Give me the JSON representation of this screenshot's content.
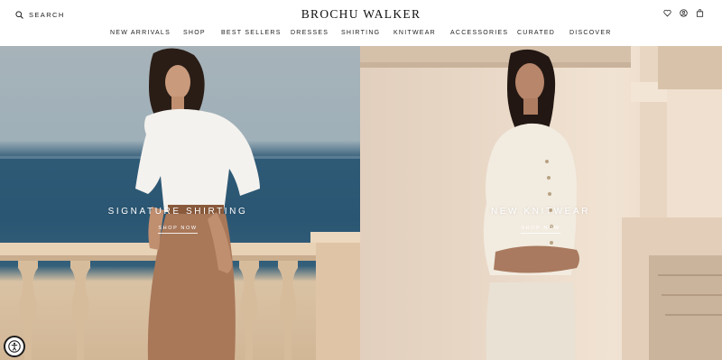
{
  "header": {
    "search_label": "SEARCH",
    "logo": "BROCHU WALKER",
    "icons": [
      "heart-icon",
      "user-icon",
      "bag-icon"
    ]
  },
  "nav": {
    "items": [
      "NEW ARRIVALS",
      "SHOP",
      "BEST SELLERS",
      "DRESSES",
      "SHIRTING",
      "KNITWEAR",
      "ACCESSORIES",
      "CURATED",
      "DISCOVER"
    ]
  },
  "hero": {
    "left": {
      "title": "SIGNATURE SHIRTING",
      "link": "SHOP NOW"
    },
    "right": {
      "title": "NEW KNITWEAR",
      "link": "SHOP NOW"
    }
  },
  "accessibility": {
    "icon": "accessibility-icon"
  },
  "colors": {
    "text": "#1a1a1a",
    "sea": "#2a5673",
    "stone": "#d9c2a4",
    "wall": "#ead9c8"
  }
}
